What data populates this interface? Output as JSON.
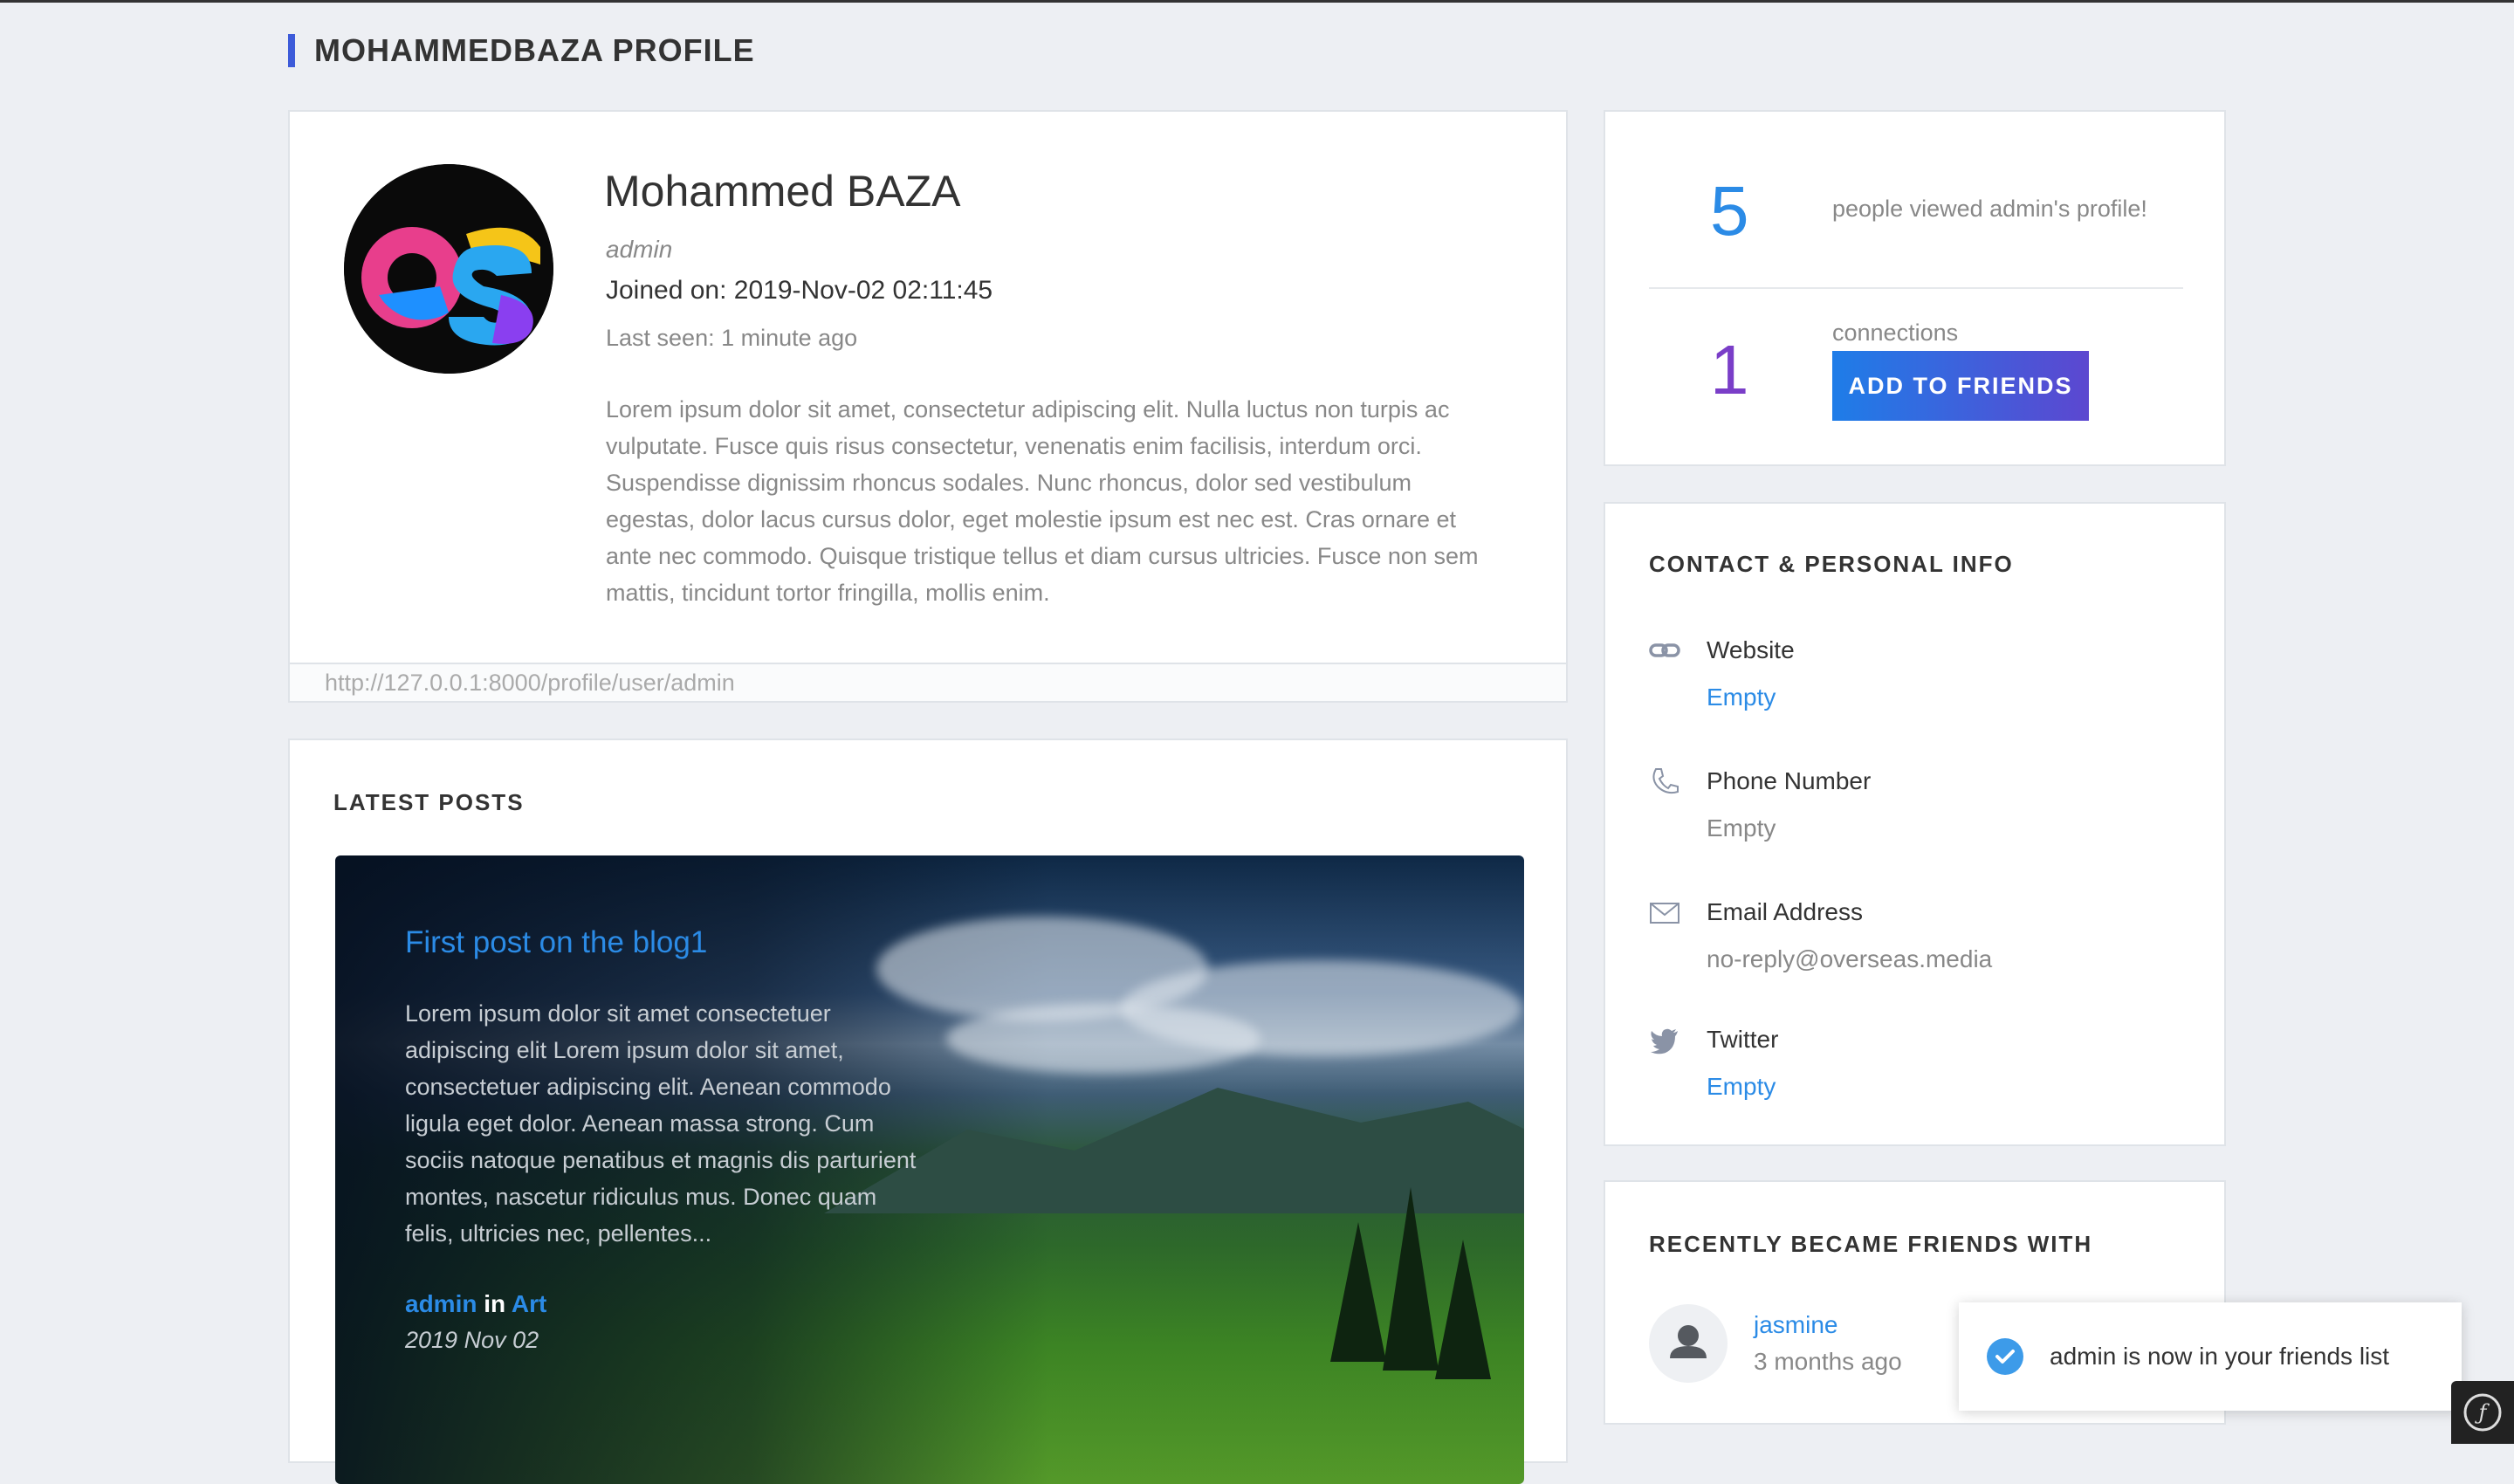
{
  "page": {
    "title": "MOHAMMEDBAZA PROFILE"
  },
  "profile": {
    "name": "Mohammed BAZA",
    "role": "admin",
    "joined": "Joined on: 2019-Nov-02 02:11:45",
    "last_seen": "Last seen: 1 minute ago",
    "bio": "Lorem ipsum dolor sit amet, consectetur adipiscing elit. Nulla luctus non turpis ac vulputate. Fusce quis risus consectetur, venenatis enim facilisis, interdum orci. Suspendisse dignissim rhoncus sodales. Nunc rhoncus, dolor sed vestibulum egestas, dolor lacus cursus dolor, eget molestie ipsum est nec est. Cras ornare et ante nec commodo. Quisque tristique tellus et diam cursus ultricies. Fusce non sem mattis, tincidunt tortor fringilla, mollis enim.",
    "url": "http://127.0.0.1:8000/profile/user/admin",
    "avatar_icon": "os-logo-icon"
  },
  "latest_posts": {
    "heading": "LATEST POSTS",
    "posts": [
      {
        "title": "First post on the blog1",
        "excerpt": "Lorem ipsum dolor sit amet consectetuer adipiscing elit Lorem ipsum dolor sit amet, consectetuer adipiscing elit. Aenean commodo ligula eget dolor. Aenean massa strong. Cum sociis natoque penatibus et magnis dis parturient montes, nascetur ridiculus mus. Donec quam felis, ultricies nec, pellentes...",
        "author": "admin",
        "in_word": "in",
        "category": "Art",
        "date": "2019 Nov 02"
      }
    ]
  },
  "stats": {
    "views_count": "5",
    "views_label": "people viewed admin's profile!",
    "connections_count": "1",
    "connections_label": "connections",
    "add_friend_label": "ADD TO FRIENDS"
  },
  "contact": {
    "heading": "CONTACT & PERSONAL INFO",
    "items": [
      {
        "icon": "link-icon",
        "label": "Website",
        "value": "Empty"
      },
      {
        "icon": "phone-icon",
        "label": "Phone Number",
        "value": "Empty"
      },
      {
        "icon": "email-icon",
        "label": "Email Address",
        "value": "no-reply@overseas.media"
      },
      {
        "icon": "twitter-icon",
        "label": "Twitter",
        "value": "Empty"
      }
    ]
  },
  "friends": {
    "heading": "RECENTLY BECAME FRIENDS WITH",
    "items": [
      {
        "name": "jasmine",
        "time": "3 months ago"
      }
    ]
  },
  "toast": {
    "message": "admin is now in your friends list"
  },
  "colors": {
    "accent_blue": "#2b8be6",
    "accent_purple": "#7a3ec8",
    "title_bar": "#3d5bd9"
  }
}
